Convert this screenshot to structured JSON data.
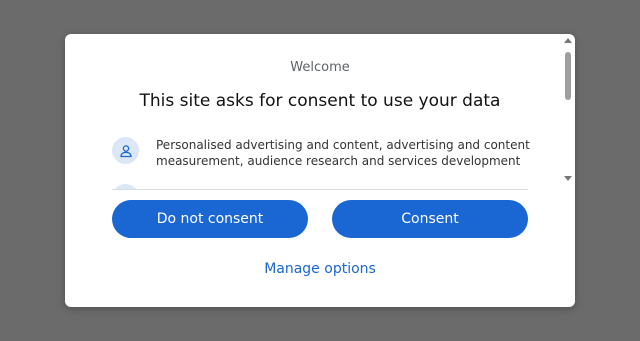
{
  "dialog": {
    "welcome": "Welcome",
    "headline": "This site asks for consent to use your data",
    "purposes": [
      {
        "icon": "person-icon",
        "text": "Personalised advertising and content, advertising and content measurement, audience research and services development"
      }
    ],
    "buttons": {
      "do_not_consent": "Do not consent",
      "consent": "Consent"
    },
    "manage_options": "Manage options"
  },
  "colors": {
    "overlay": "#6b6b6b",
    "primary": "#1a66d2",
    "icon_bg": "#dbe7f7"
  }
}
